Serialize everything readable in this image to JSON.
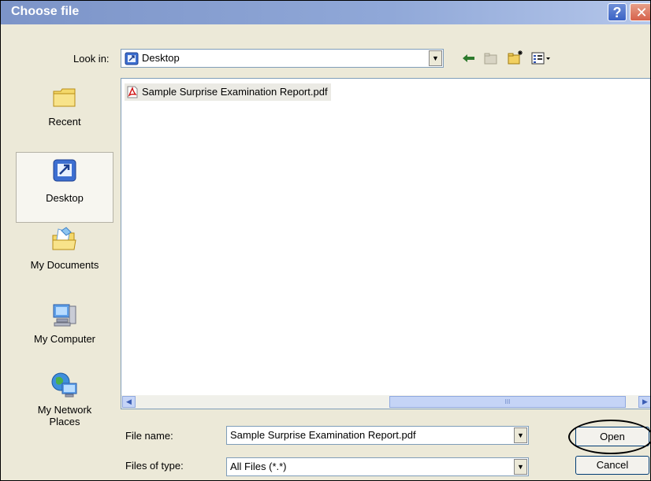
{
  "window": {
    "title": "Choose file",
    "help_label": "?",
    "close_label": "✕"
  },
  "look_in": {
    "label": "Look in:",
    "value": "Desktop",
    "icon": "desktop-icon"
  },
  "toolbar": {
    "icons": [
      "back-arrow-icon",
      "up-folder-icon",
      "new-folder-icon",
      "view-menu-icon"
    ]
  },
  "places": [
    {
      "label": "Recent",
      "icon": "recent-folder-icon",
      "selected": false
    },
    {
      "label": "Desktop",
      "icon": "desktop-icon",
      "selected": true
    },
    {
      "label": "My Documents",
      "icon": "my-documents-icon",
      "selected": false
    },
    {
      "label": "My Computer",
      "icon": "my-computer-icon",
      "selected": false
    },
    {
      "label": "My Network Places",
      "icon": "network-places-icon",
      "selected": false
    }
  ],
  "files": [
    {
      "name": "Sample Surprise Examination Report.pdf",
      "icon": "pdf-icon"
    }
  ],
  "filename": {
    "label": "File name:",
    "value": "Sample Surprise Examination Report.pdf"
  },
  "filetype": {
    "label": "Files of type:",
    "value": "All Files (*.*)"
  },
  "buttons": {
    "open": "Open",
    "cancel": "Cancel"
  },
  "scroll": {
    "thumb_grip": "III"
  },
  "colors": {
    "title_bar": "#7c94c8",
    "dialog_bg": "#ece9d8",
    "close_btn": "#d6614a"
  }
}
